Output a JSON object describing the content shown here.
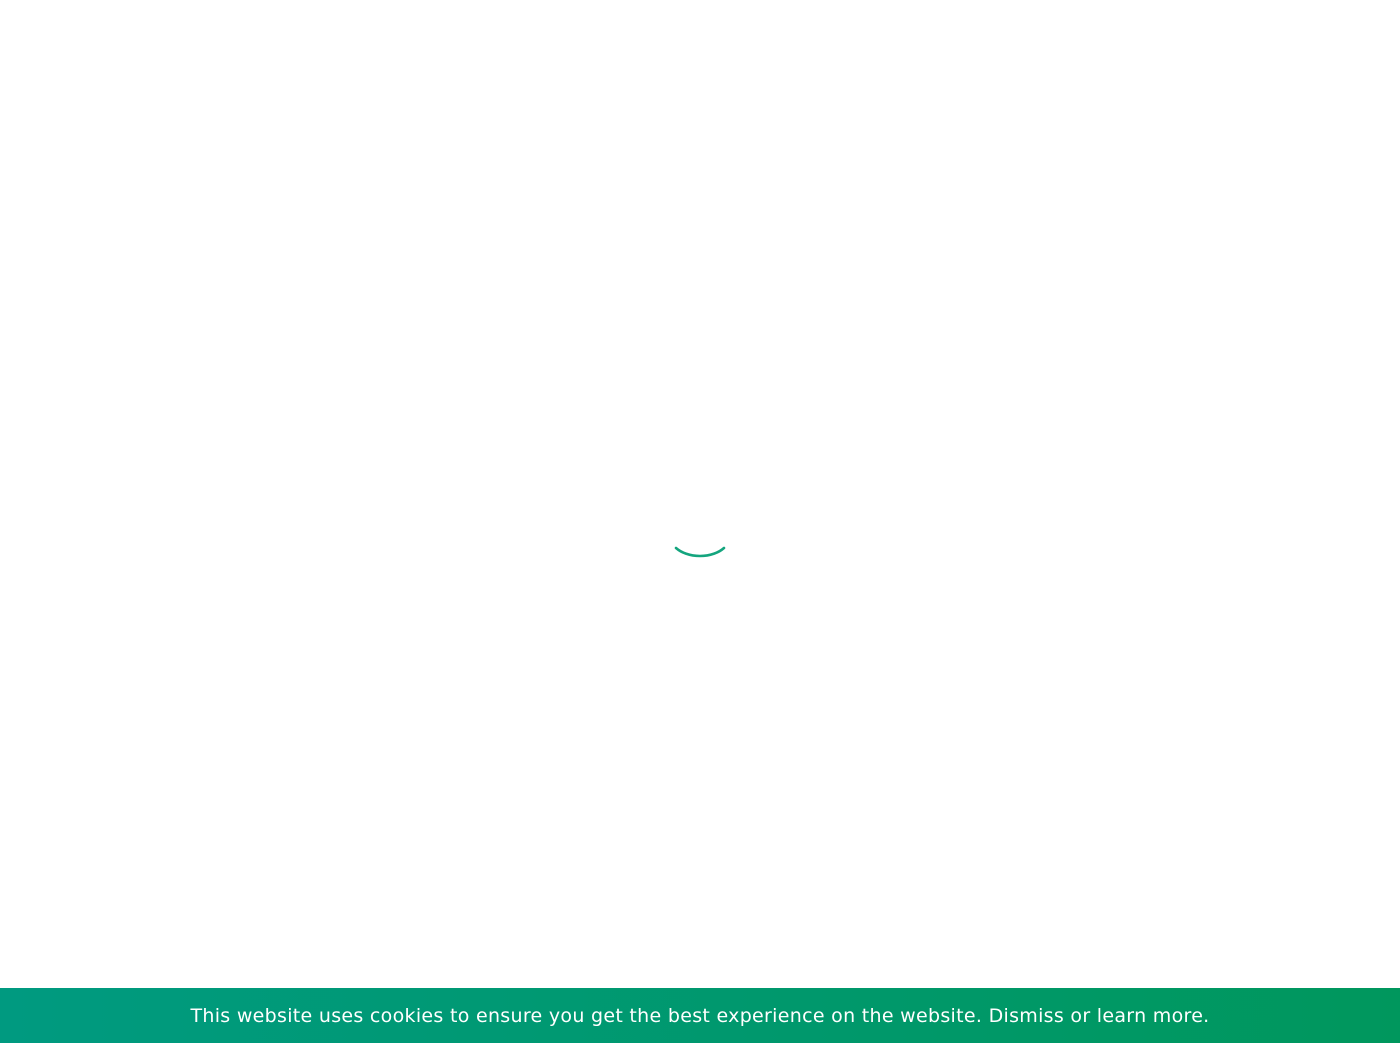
{
  "loader": {
    "icon": "loading-spinner-icon",
    "color": "#14a57e"
  },
  "cookie_bar": {
    "background_start": "#009a80",
    "background_end": "#00975d",
    "message": "This website uses cookies to ensure you get the best experience on the website.",
    "dismiss_label": "Dismiss",
    "or_text": "or",
    "learn_more_label": "learn more."
  }
}
